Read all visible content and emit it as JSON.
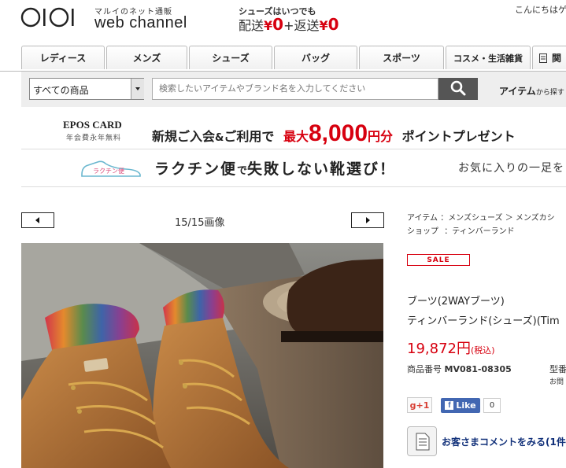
{
  "header": {
    "logo_mark": "OIOI",
    "logo_sub": "マルイのネット通販",
    "logo_main": "web channel",
    "shipping_top": "シューズはいつでも",
    "shipping_label1": "配送",
    "shipping_yen1": "¥",
    "shipping_val1": "0",
    "shipping_plus": "+返送",
    "shipping_yen2": "¥",
    "shipping_val2": "0",
    "greeting": "こんにちはゲ"
  },
  "tabs": [
    "レディース",
    "メンズ",
    "シューズ",
    "バッグ",
    "スポーツ",
    "コスメ・生活雑貨",
    "関"
  ],
  "search": {
    "category": "すべての商品",
    "placeholder": "検索したいアイテムやブランド名を入力してください",
    "item_label": "アイテム",
    "item_suffix": "から探す"
  },
  "epos": {
    "card": "EPOS CARD",
    "fee": "年会費永年無料",
    "text1": "新規ご入会",
    "amp": "&",
    "text2": "ご利用で",
    "max": "最大",
    "amount": "8,000",
    "yen": "円分",
    "text3": "ポイントプレゼント"
  },
  "rakuchin": {
    "badge": "ラクチン便",
    "title1": "ラクチン便",
    "de": "で",
    "title2": "失敗しない靴選び！",
    "right": "お気に入りの一足を"
  },
  "gallery": {
    "counter": "15/15画像"
  },
  "product": {
    "crumb1_label": "アイテム",
    "crumb1_sep": "：",
    "crumb1_a": "メンズシューズ",
    "crumb1_arrow": "＞",
    "crumb1_b": "メンズカシ",
    "crumb2_label": "ショップ",
    "crumb2_sep": "：",
    "crumb2_a": "ティンバーランド",
    "sale": "SALE",
    "name1": "ブーツ(2WAYブーツ)",
    "name2": "ティンバーランド(シューズ)(Tim",
    "price": "19,872",
    "price_unit": "円",
    "price_tax": "(税込)",
    "sku_label": "商品番号",
    "sku": "MV081-08305",
    "model_label": "型番",
    "model_sub": "お問",
    "gplus": "g+1",
    "fb_like": "Like",
    "fb_count": "0",
    "comment_link": "お客さまコメントをみる(1件"
  }
}
